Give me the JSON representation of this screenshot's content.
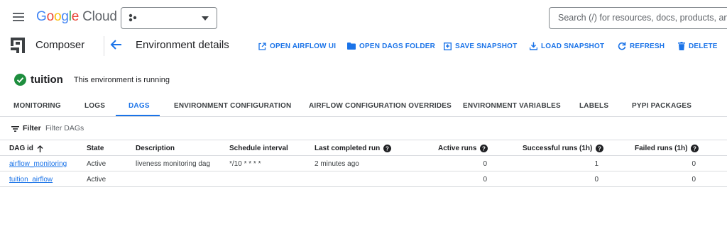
{
  "topbar": {
    "logo_letters": [
      "G",
      "o",
      "o",
      "g",
      "l",
      "e"
    ],
    "logo_cloud": "Cloud",
    "search_placeholder": "Search (/) for resources, docs, products, and"
  },
  "subheader": {
    "product_name": "Composer",
    "page_title": "Environment details",
    "actions": [
      {
        "label": "OPEN AIRFLOW UI",
        "icon": "external-link-icon"
      },
      {
        "label": "OPEN DAGS FOLDER",
        "icon": "folder-icon"
      },
      {
        "label": "SAVE SNAPSHOT",
        "icon": "save-icon"
      },
      {
        "label": "LOAD SNAPSHOT",
        "icon": "download-icon"
      },
      {
        "label": "REFRESH",
        "icon": "refresh-icon"
      },
      {
        "label": "DELETE",
        "icon": "trash-icon"
      }
    ]
  },
  "environment": {
    "name": "tuition",
    "status": "This environment is running",
    "status_color": "#1e8e3e"
  },
  "tabs": [
    "MONITORING",
    "LOGS",
    "DAGS",
    "ENVIRONMENT CONFIGURATION",
    "AIRFLOW CONFIGURATION OVERRIDES",
    "ENVIRONMENT VARIABLES",
    "LABELS",
    "PYPI PACKAGES"
  ],
  "active_tab": "DAGS",
  "filter": {
    "label": "Filter",
    "placeholder": "Filter DAGs"
  },
  "table": {
    "columns": [
      "DAG id",
      "State",
      "Description",
      "Schedule interval",
      "Last completed run",
      "Active runs",
      "Successful runs (1h)",
      "Failed runs (1h)"
    ],
    "sort_column": "DAG id",
    "sort_direction": "ascending",
    "rows": [
      {
        "dag_id": "airflow_monitoring",
        "state": "Active",
        "description": "liveness monitoring dag",
        "schedule": "*/10 * * * *",
        "last_run": "2 minutes ago",
        "active_runs": "0",
        "successful_runs": "1",
        "failed_runs": "0"
      },
      {
        "dag_id": "tuition_airflow",
        "state": "Active",
        "description": "",
        "schedule": "",
        "last_run": "",
        "active_runs": "0",
        "successful_runs": "0",
        "failed_runs": "0"
      }
    ]
  },
  "colors": {
    "accent": "#1a73e8",
    "text": "#202124",
    "divider": "#dadce0"
  }
}
